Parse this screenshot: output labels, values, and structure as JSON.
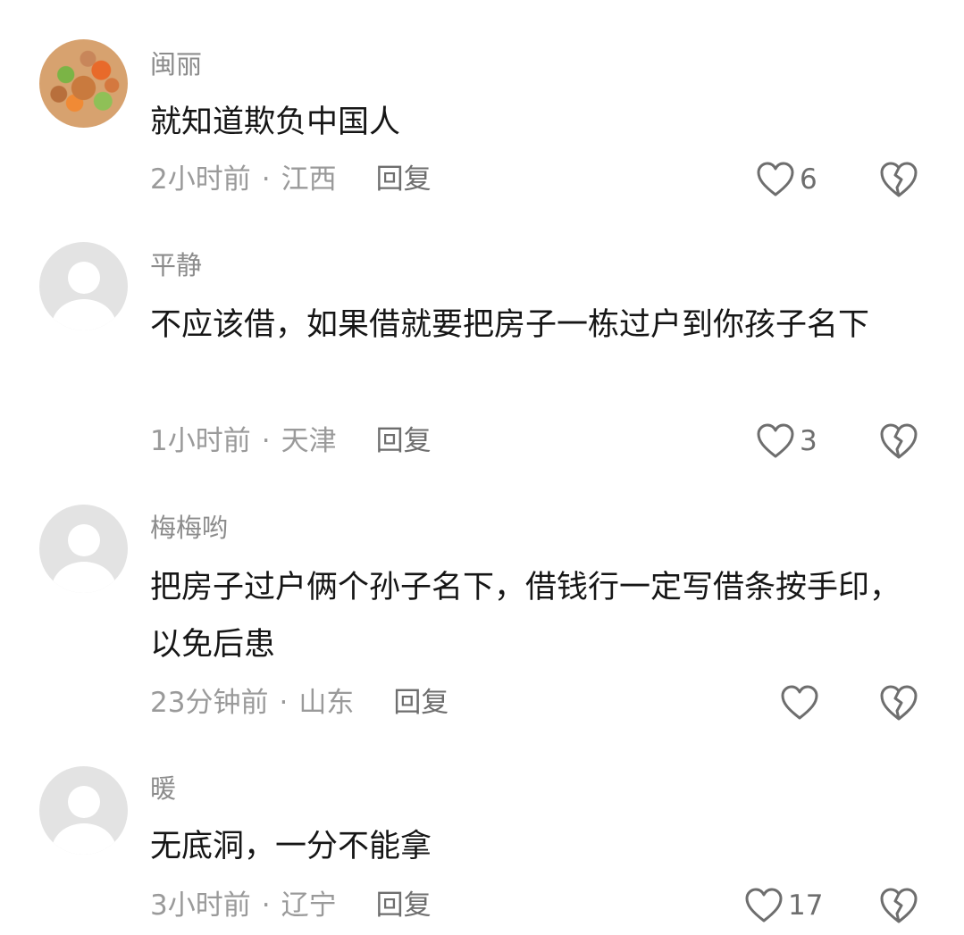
{
  "comments": [
    {
      "username": "闽丽",
      "avatar": "food-photo-avatar",
      "content": "就知道欺负中国人",
      "time": "2小时前",
      "location": "江西",
      "reply_label": "回复",
      "likes": "6"
    },
    {
      "username": "平静",
      "avatar": "default-user-avatar",
      "content": "不应该借，如果借就要把房子一栋过户到你孩子名下",
      "time": "1小时前",
      "location": "天津",
      "reply_label": "回复",
      "likes": "3"
    },
    {
      "username": "梅梅哟",
      "avatar": "default-user-avatar",
      "content": "把房子过户俩个孙子名下，借钱行一定写借条按手印，以免后患",
      "time": "23分钟前",
      "location": "山东",
      "reply_label": "回复",
      "likes": ""
    },
    {
      "username": "暖",
      "avatar": "default-user-avatar",
      "content": "无底洞，一分不能拿",
      "time": "3小时前",
      "location": "辽宁",
      "reply_label": "回复",
      "likes": "17"
    }
  ],
  "meta_separator": "·",
  "icons": {
    "like": "heart-outline-icon",
    "dislike": "broken-heart-icon"
  },
  "colors": {
    "text": "#161616",
    "muted": "#9a9a9a",
    "icon": "#6e6e6e"
  }
}
